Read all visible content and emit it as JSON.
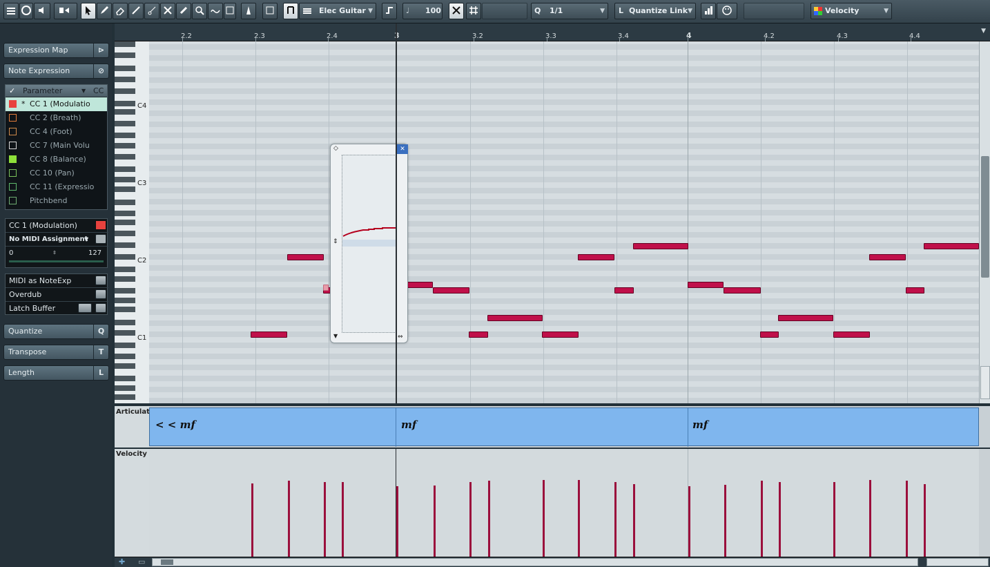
{
  "toolbar": {
    "track_name": "Elec Guitar",
    "velocity_value": "100",
    "quantize_value": "1/1",
    "length_quantize": "Quantize Link",
    "lane_param": "Velocity",
    "quantize_icon_label": "Q",
    "length_icon_label": "L"
  },
  "inspector": {
    "expression_map": "Expression Map",
    "note_expression": "Note Expression",
    "table_header_param": "Parameter",
    "table_header_cc": "CC",
    "params": [
      {
        "label": "CC 1  (Modulatio",
        "color": "#e8423e",
        "selected": true,
        "starred": true,
        "filled": true
      },
      {
        "label": "CC 2  (Breath)",
        "color": "#e07a39",
        "selected": false,
        "starred": false,
        "filled": false
      },
      {
        "label": "CC 4  (Foot)",
        "color": "#d08b4b",
        "selected": false,
        "starred": false,
        "filled": false
      },
      {
        "label": "CC 7  (Main Volu",
        "color": "#d9d9d9",
        "selected": false,
        "starred": false,
        "filled": false
      },
      {
        "label": "CC 8  (Balance)",
        "color": "#8ee03a",
        "selected": false,
        "starred": false,
        "filled": true
      },
      {
        "label": "CC 10  (Pan)",
        "color": "#7bc35a",
        "selected": false,
        "starred": false,
        "filled": false
      },
      {
        "label": "CC 11  (Expressio",
        "color": "#5eb96b",
        "selected": false,
        "starred": false,
        "filled": false
      },
      {
        "label": "Pitchbend",
        "color": "#6fae72",
        "selected": false,
        "starred": false,
        "filled": false
      }
    ],
    "selected_param": "CC 1  (Modulation)",
    "midi_assignment": "No MIDI Assignment",
    "range_min": "0",
    "range_max": "127",
    "midi_as_noteexp": "MIDI as NoteExp",
    "overdub": "Overdub",
    "latch_buffer": "Latch Buffer",
    "quantize": "Quantize",
    "quantize_key": "Q",
    "transpose": "Transpose",
    "transpose_key": "T",
    "length": "Length",
    "length_key": "L"
  },
  "ruler": {
    "ticks": [
      "2.2",
      "2.3",
      "2.4",
      "3",
      "3.2",
      "3.3",
      "3.4",
      "4",
      "4.2",
      "4.3",
      "4.4"
    ]
  },
  "keyboard": {
    "labels": [
      "C4",
      "C3",
      "C2",
      "C1"
    ]
  },
  "lanes": {
    "articulation_label": "Articulatio",
    "velocity_label": "Velocity",
    "dynamics": [
      "< < mf",
      "mf",
      "mf"
    ]
  },
  "notes_count": 28
}
